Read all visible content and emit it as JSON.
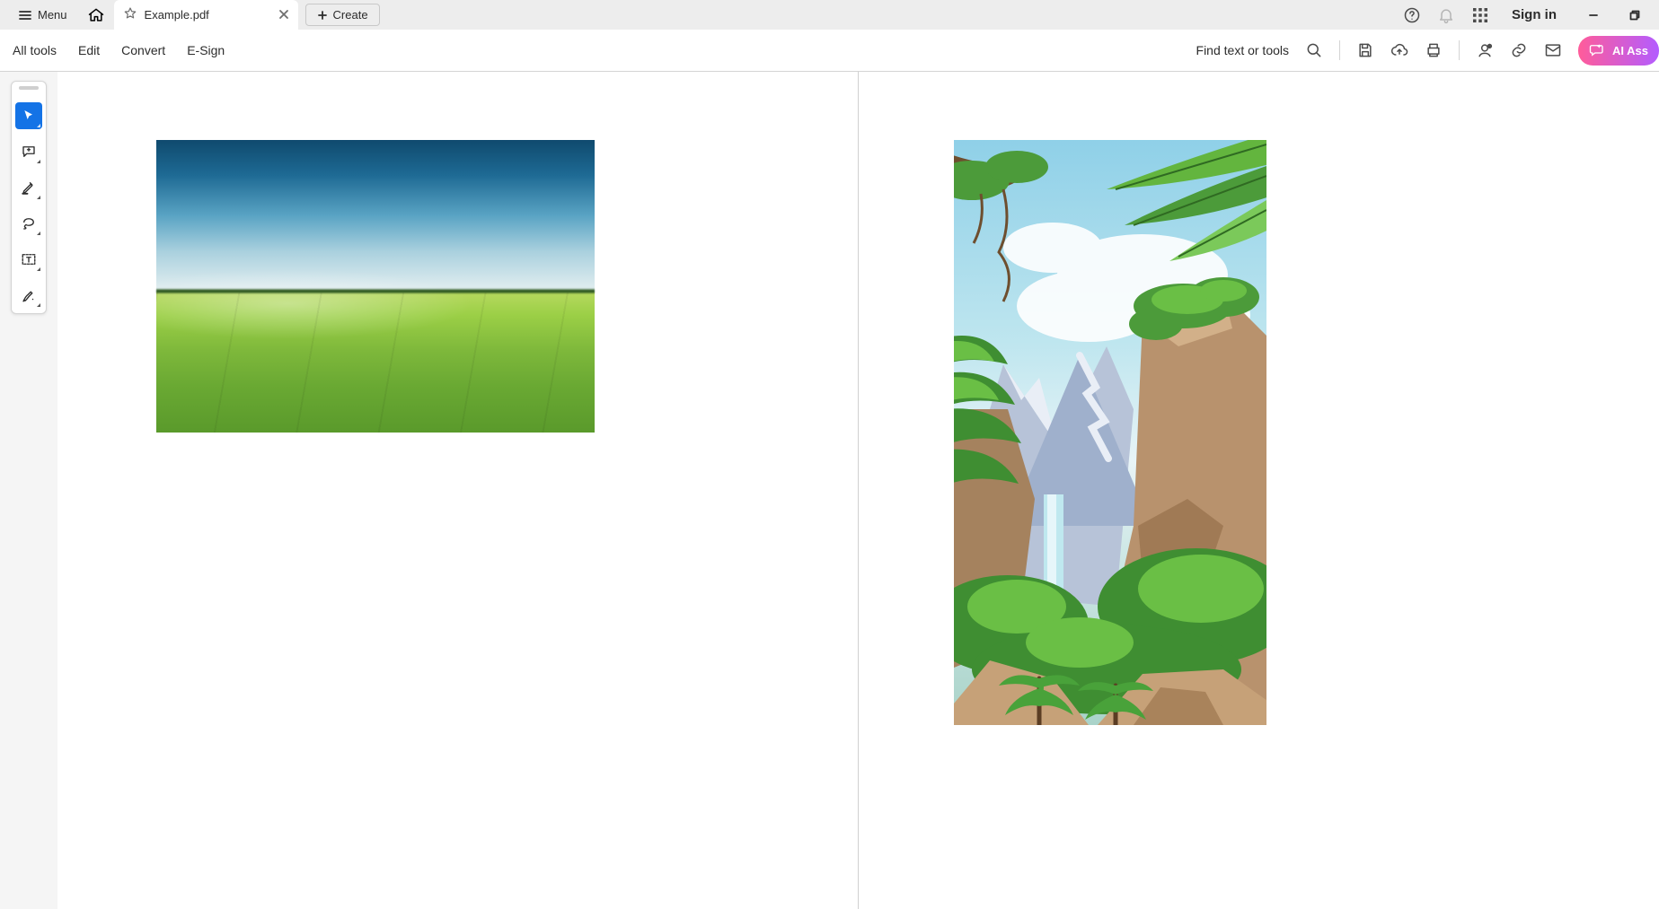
{
  "titlebar": {
    "menu_label": "Menu",
    "tab": {
      "filename": "Example.pdf"
    },
    "create_label": "Create",
    "sign_in_label": "Sign in"
  },
  "toolbar": {
    "links": {
      "all_tools": "All tools",
      "edit": "Edit",
      "convert": "Convert",
      "esign": "E-Sign"
    },
    "find_label": "Find text or tools",
    "ai_label": "AI Ass"
  },
  "palette": {
    "tools": [
      {
        "name": "select",
        "active": true
      },
      {
        "name": "comment",
        "active": false
      },
      {
        "name": "highlight",
        "active": false
      },
      {
        "name": "draw",
        "active": false
      },
      {
        "name": "textbox",
        "active": false
      },
      {
        "name": "fill-sign",
        "active": false
      }
    ]
  },
  "document": {
    "pages": [
      {
        "content": "landscape-field-image"
      },
      {
        "content": "tropical-jungle-illustration"
      }
    ]
  }
}
